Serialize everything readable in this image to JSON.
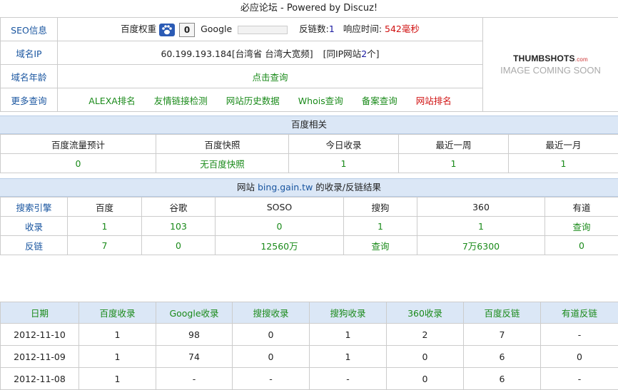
{
  "title": "必应论坛 - Powered by Discuz!",
  "info": {
    "seo_label": "SEO信息",
    "baidu_weight_label": "百度权重",
    "baidu_weight_value": "0",
    "google_label": "Google",
    "backlinks_label": "反链数:",
    "backlinks_value": "1",
    "response_label": "响应时间:",
    "response_value": "542毫秒",
    "ip_label": "域名IP",
    "ip_value": "60.199.193.184[台湾省 台湾大宽频]",
    "same_ip_prefix": "[同IP网站",
    "same_ip_count": "2",
    "same_ip_suffix": "个]",
    "age_label": "域名年龄",
    "age_link": "点击查询",
    "more_label": "更多查询",
    "more_links": [
      "ALEXA排名",
      "友情链接检测",
      "网站历史数据",
      "Whois查询",
      "备案查询",
      "网站排名"
    ],
    "thumb_logo": "THUMBSHOTS",
    "thumb_logo_suffix": ".com",
    "thumb_sub": "IMAGE COMING SOON"
  },
  "baidu_section": {
    "heading": "百度相关",
    "headers": [
      "百度流量预计",
      "百度快照",
      "今日收录",
      "最近一周",
      "最近一月"
    ],
    "values": [
      "0",
      "无百度快照",
      "1",
      "1",
      "1"
    ]
  },
  "search_section": {
    "heading_prefix": "网站",
    "domain": "bing.gain.tw",
    "heading_suffix": "的收录/反链结果",
    "headers": [
      "搜索引擎",
      "百度",
      "谷歌",
      "SOSO",
      "搜狗",
      "360",
      "有道"
    ],
    "rows": [
      {
        "label": "收录",
        "values": [
          "1",
          "103",
          "0",
          "1",
          "1",
          "查询"
        ]
      },
      {
        "label": "反链",
        "values": [
          "7",
          "0",
          "12560万",
          "查询",
          "7万6300",
          "0"
        ]
      }
    ]
  },
  "daily": {
    "headers": [
      "日期",
      "百度收录",
      "Google收录",
      "搜搜收录",
      "搜狗收录",
      "360收录",
      "百度反链",
      "有道反链"
    ],
    "rows": [
      [
        "2012-11-10",
        "1",
        "98",
        "0",
        "1",
        "2",
        "7",
        "-"
      ],
      [
        "2012-11-09",
        "1",
        "74",
        "0",
        "1",
        "0",
        "6",
        "0"
      ],
      [
        "2012-11-08",
        "1",
        "-",
        "-",
        "-",
        "0",
        "6",
        "-"
      ]
    ]
  }
}
